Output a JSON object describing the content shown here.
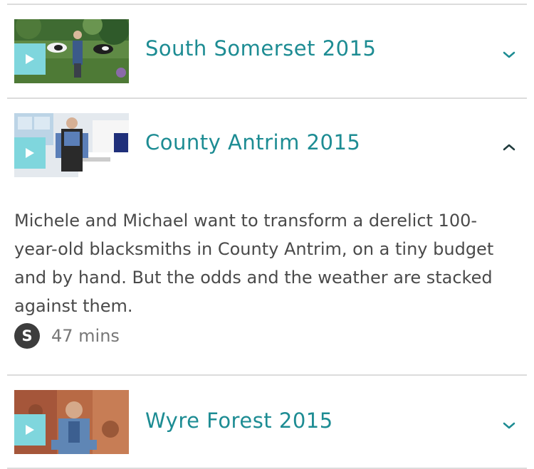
{
  "episodes": [
    {
      "title": "South Somerset 2015",
      "expanded": false,
      "chevron_icon": "chevron-down-icon",
      "thumbnail": "presenter-in-field-with-cows"
    },
    {
      "title": "County Antrim 2015",
      "expanded": true,
      "chevron_icon": "chevron-up-icon",
      "thumbnail": "presenter-in-modern-kitchen",
      "description": "Michele and Michael want to transform a derelict 100-year-old blacksmiths in County Antrim, on a tiny budget and by hand. But the odds and the weather are stacked against them.",
      "subtitle_badge": "S",
      "duration": "47 mins"
    },
    {
      "title": "Wyre Forest 2015",
      "expanded": false,
      "chevron_icon": "chevron-down-icon",
      "thumbnail": "presenter-by-sandstone-rock"
    }
  ],
  "colors": {
    "title": "#1d8c93",
    "play_background": "#7fd6dd",
    "description": "#4a4a4a",
    "divider": "#dcdcdc"
  }
}
